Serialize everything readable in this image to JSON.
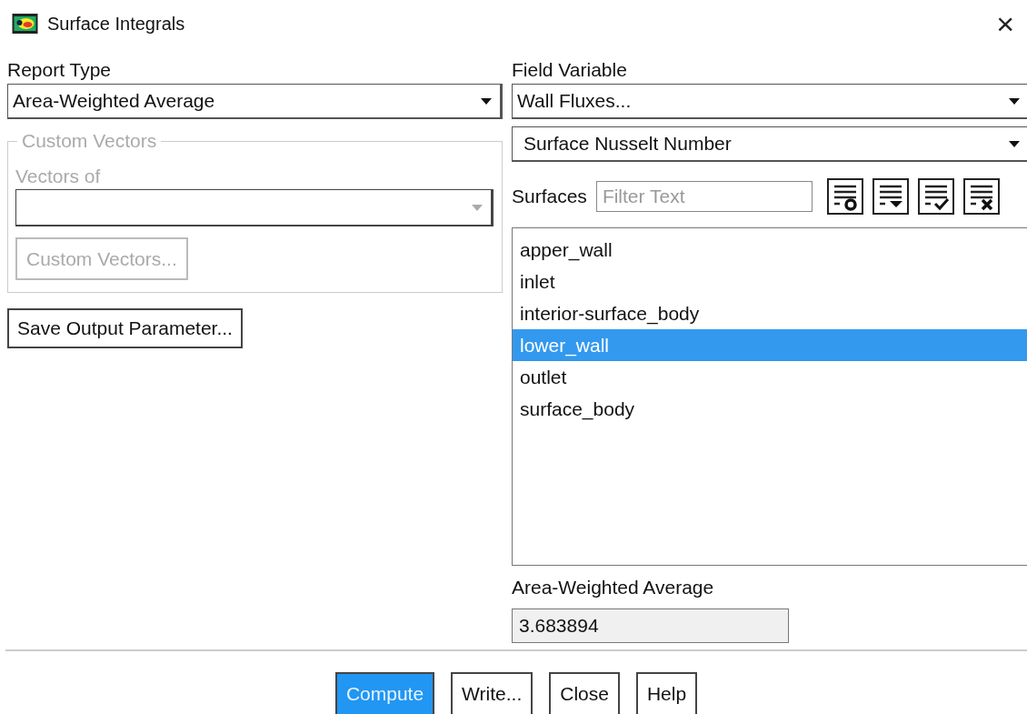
{
  "window": {
    "title": "Surface Integrals",
    "close": "×"
  },
  "report_type": {
    "label": "Report Type",
    "value": "Area-Weighted Average"
  },
  "custom_vectors": {
    "legend": "Custom Vectors",
    "disabled": true,
    "vectors_of_label": "Vectors of",
    "button": "Custom Vectors..."
  },
  "save_button": "Save Output Parameter...",
  "field_variable": {
    "label": "Field Variable",
    "category": "Wall Fluxes...",
    "variable": "Surface Nusselt Number"
  },
  "surfaces": {
    "label": "Surfaces",
    "filter_placeholder": "Filter Text",
    "items": [
      {
        "name": "apper_wall",
        "selected": false
      },
      {
        "name": "inlet",
        "selected": false
      },
      {
        "name": "interior-surface_body",
        "selected": false
      },
      {
        "name": "lower_wall",
        "selected": true
      },
      {
        "name": "outlet",
        "selected": false
      },
      {
        "name": "surface_body",
        "selected": false
      }
    ]
  },
  "result": {
    "label": "Area-Weighted Average",
    "value": "3.683894"
  },
  "buttons": [
    {
      "label": "Compute",
      "default": true
    },
    {
      "label": "Write...",
      "default": false
    },
    {
      "label": "Close",
      "default": false
    },
    {
      "label": "Help",
      "default": false
    }
  ]
}
